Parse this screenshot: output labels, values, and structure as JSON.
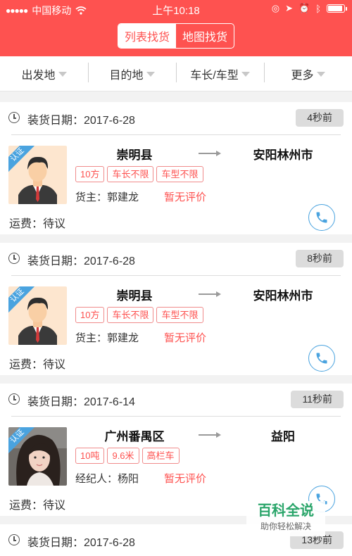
{
  "status_bar": {
    "carrier": "中国移动",
    "time": "上午10:18"
  },
  "segment": {
    "list_label": "列表找货",
    "map_label": "地图找货"
  },
  "filters": [
    "出发地",
    "目的地",
    "车长/车型",
    "更多"
  ],
  "cards": [
    {
      "date": "装货日期：2017-6-28",
      "ago": "4秒前",
      "badge": "认证",
      "origin": "崇明县",
      "destination": "安阳林州市",
      "tags": [
        "10方",
        "车长不限",
        "车型不限"
      ],
      "owner": "货主：郭建龙",
      "rating": "暂无评价",
      "fee": "运费：待议",
      "avatar": "man-avatar"
    },
    {
      "date": "装货日期：2017-6-28",
      "ago": "8秒前",
      "badge": "认证",
      "origin": "崇明县",
      "destination": "安阳林州市",
      "tags": [
        "10方",
        "车长不限",
        "车型不限"
      ],
      "owner": "货主：郭建龙",
      "rating": "暂无评价",
      "fee": "运费：待议",
      "avatar": "man-avatar"
    },
    {
      "date": "装货日期：2017-6-14",
      "ago": "11秒前",
      "badge": "认证",
      "origin": "广州番禺区",
      "destination": "益阳",
      "tags": [
        "10吨",
        "9.6米",
        "高栏车"
      ],
      "owner": "经纪人：杨阳",
      "rating": "暂无评价",
      "fee": "运费：待议",
      "avatar": "woman-photo"
    },
    {
      "date": "装货日期：2017-6-28",
      "ago": "13秒前"
    }
  ],
  "watermark": {
    "title": "百科全说",
    "subtitle": "助你轻松解决"
  },
  "colors": {
    "accent": "#fe5250",
    "phone": "#4aa3df",
    "watermark": "#2aa56a"
  }
}
